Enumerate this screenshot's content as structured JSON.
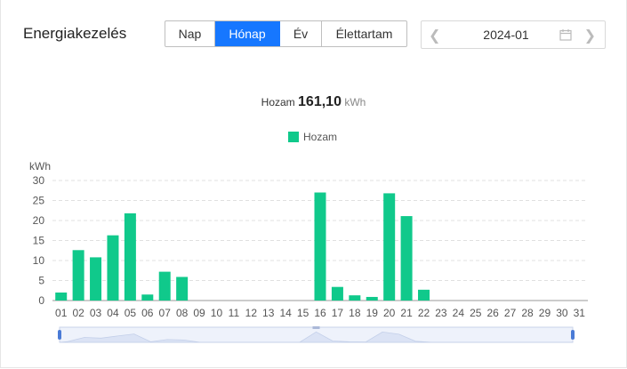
{
  "header": {
    "title": "Energiakezelés",
    "tabs": [
      {
        "label": "Nap",
        "active": false
      },
      {
        "label": "Hónap",
        "active": true
      },
      {
        "label": "Év",
        "active": false
      },
      {
        "label": "Élettartam",
        "active": false
      }
    ],
    "date": {
      "value": "2024-01",
      "prev_icon": "chevron-left-icon",
      "next_icon": "chevron-right-icon",
      "calendar_icon": "calendar-icon"
    }
  },
  "summary": {
    "label": "Hozam",
    "value": "161,10",
    "unit": "kWh"
  },
  "legend": {
    "label": "Hozam"
  },
  "colors": {
    "accent": "#1677ff",
    "bar": "#10c98b",
    "grid": "#e0e0e0",
    "axis": "#555555"
  },
  "chart_data": {
    "type": "bar",
    "ylabel": "kWh",
    "ylim": [
      0,
      30
    ],
    "yticks": [
      0,
      5,
      10,
      15,
      20,
      25,
      30
    ],
    "categories": [
      "01",
      "02",
      "03",
      "04",
      "05",
      "06",
      "07",
      "08",
      "09",
      "10",
      "11",
      "12",
      "13",
      "14",
      "15",
      "16",
      "17",
      "18",
      "19",
      "20",
      "21",
      "22",
      "23",
      "24",
      "25",
      "26",
      "27",
      "28",
      "29",
      "30",
      "31"
    ],
    "series": [
      {
        "name": "Hozam",
        "values": [
          2.0,
          12.6,
          10.8,
          16.3,
          21.8,
          1.5,
          7.2,
          5.9,
          0,
          0,
          0,
          0,
          0,
          0,
          0,
          27.0,
          3.4,
          1.3,
          0.9,
          26.8,
          21.1,
          2.7,
          0,
          0,
          0,
          0,
          0,
          0,
          0,
          0,
          0
        ]
      }
    ],
    "grid": true,
    "legend_position": "top-center"
  }
}
